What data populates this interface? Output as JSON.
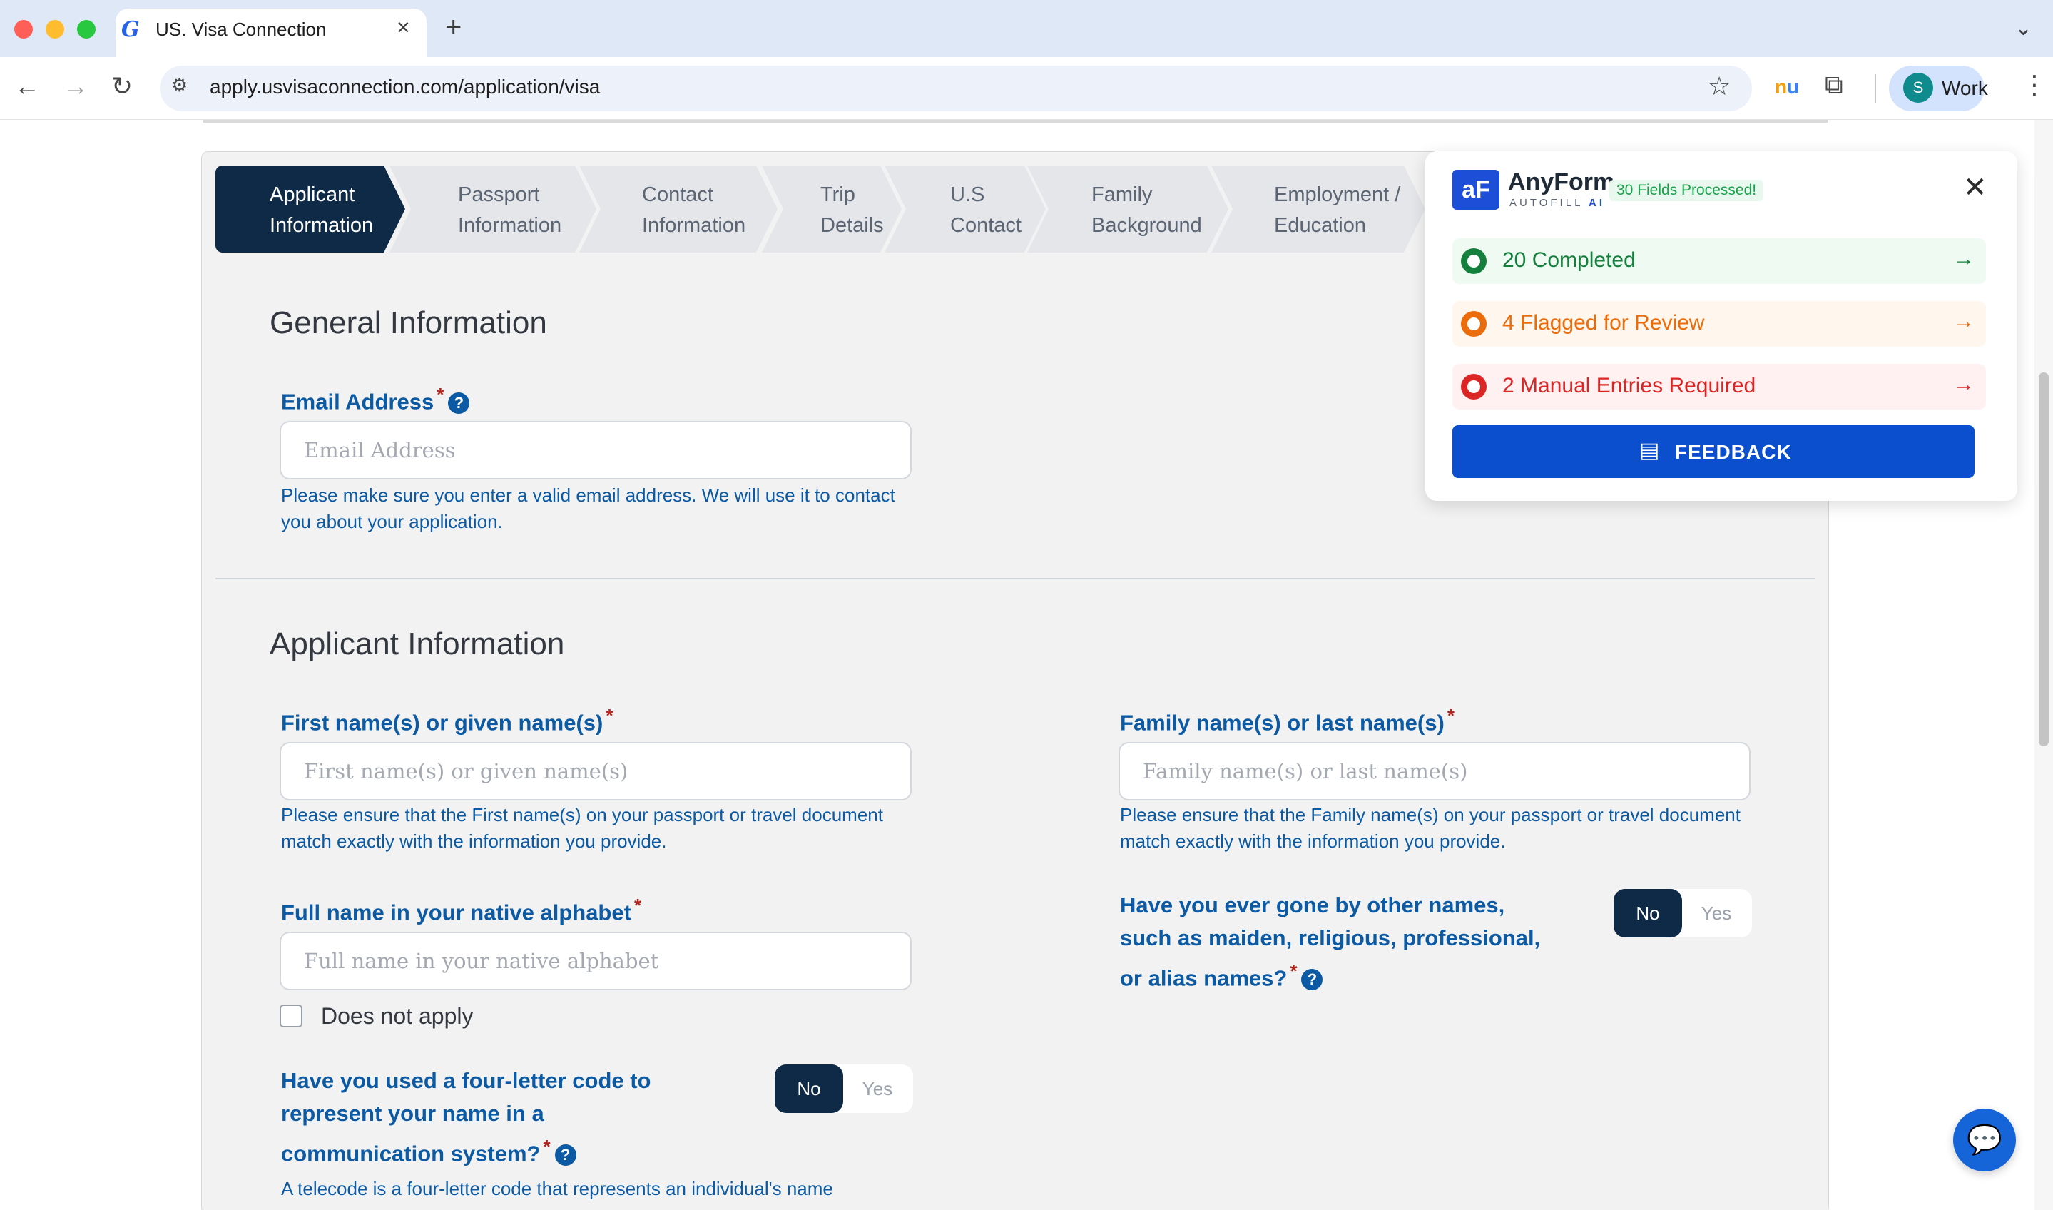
{
  "browser": {
    "tab_title": "US. Visa Connection",
    "url": "apply.usvisaconnection.com/application/visa",
    "profile_initial": "S",
    "profile_name": "Work",
    "ext_nu_a": "n",
    "ext_nu_b": "u"
  },
  "stepper": [
    {
      "label": "Applicant\nInformation",
      "active": true
    },
    {
      "label": "Passport\nInformation",
      "active": false
    },
    {
      "label": "Contact\nInformation",
      "active": false
    },
    {
      "label": "Trip\nDetails",
      "active": false
    },
    {
      "label": "U.S\nContact",
      "active": false
    },
    {
      "label": "Family\nBackground",
      "active": false
    },
    {
      "label": "Employment /\nEducation",
      "active": false
    }
  ],
  "general": {
    "title": "General Information",
    "email_label": "Email Address",
    "email_placeholder": "Email Address",
    "email_hint": "Please make sure you enter a valid email address. We will use it to contact you about your application."
  },
  "applicant": {
    "title": "Applicant Information",
    "first_label": "First name(s) or given name(s)",
    "first_placeholder": "First name(s) or given name(s)",
    "first_hint": "Please ensure that the First name(s) on your passport or travel document match exactly with the information you provide.",
    "family_label": "Family name(s) or last name(s)",
    "family_placeholder": "Family name(s) or last name(s)",
    "family_hint": "Please ensure that the Family name(s) on your passport or travel document match exactly with the information you provide.",
    "native_label": "Full name in your native alphabet",
    "native_placeholder": "Full name in your native alphabet",
    "does_not_apply": "Does not apply",
    "other_names_q": "Have you ever gone by other names, such as maiden, religious, professional, or alias names?",
    "telecode_q": "Have you used a four-letter code to represent your name in a communication system?",
    "telecode_hint": "A telecode is a four-letter code that represents an individual's name",
    "no": "No",
    "yes": "Yes",
    "required_mark": "*",
    "help_mark": "?"
  },
  "anyform": {
    "logo_text": "aF",
    "name": "AnyForm",
    "sub_a": "AUTOFILL ",
    "sub_b": "AI",
    "processed": "30 Fields Processed!",
    "completed": "20 Completed",
    "flagged": "4 Flagged for Review",
    "manual": "2 Manual Entries Required",
    "feedback": "FEEDBACK",
    "colors": {
      "completed": "#15803d",
      "flagged": "#ea6c0a",
      "manual": "#dc2626"
    }
  }
}
